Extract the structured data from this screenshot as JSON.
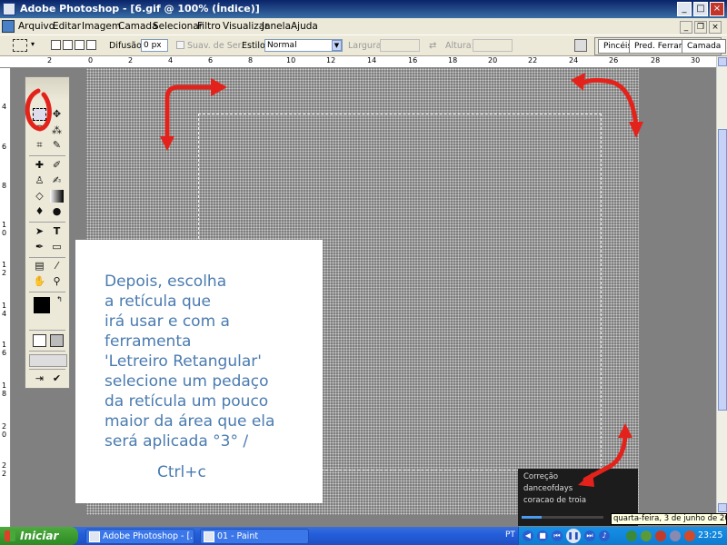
{
  "window": {
    "title": "Adobe Photoshop - [6.gif @ 100% (Índice)]",
    "controls": {
      "minimize": "_",
      "maximize": "□",
      "close": "×"
    }
  },
  "menu": [
    "Arquivo",
    "Editar",
    "Imagem",
    "Camada",
    "Selecionar",
    "Filtro",
    "Visualizar",
    "Janela",
    "Ajuda"
  ],
  "mdi_controls": {
    "minimize": "_",
    "restore": "❐",
    "close": "×"
  },
  "options": {
    "feather_label": "Difusão:",
    "feather_value": "0 px",
    "antialias_label": "Suav. de Ser.",
    "style_label": "Estilo:",
    "style_value": "Normal",
    "width_label": "Largura:",
    "height_label": "Altura:",
    "palette_tabs": [
      "Pincéis",
      "Pred. Ferram.",
      "Camada"
    ]
  },
  "rulers": {
    "top_ticks": [
      "2",
      "0",
      "2",
      "4",
      "6",
      "8",
      "10",
      "12",
      "14",
      "16",
      "18",
      "20",
      "22",
      "24",
      "26",
      "28",
      "30"
    ],
    "left_ticks": [
      "4",
      "6",
      "8",
      "1\n0",
      "1\n2",
      "1\n4",
      "1\n6",
      "1\n8",
      "2\n0",
      "2\n2"
    ]
  },
  "toolbox": {
    "tools": [
      "marquee",
      "move",
      "lasso",
      "magic-wand",
      "crop",
      "slice",
      "healing",
      "brush",
      "clone",
      "history-brush",
      "eraser",
      "gradient",
      "blur",
      "dodge",
      "path-select",
      "type",
      "pen",
      "shape",
      "notes",
      "eyedropper",
      "hand",
      "zoom"
    ]
  },
  "caption": {
    "lines": [
      "Depois, escolha",
      "a retícula   que",
      "irá usar e com a",
      "ferramenta",
      "'Letreiro Retangular'",
      "selecione um pedaço",
      "da retícula um pouco",
      "maior da área que ela",
      "será aplicada °3° /",
      "Ctrl+c"
    ]
  },
  "media": {
    "tracks": [
      "Correção",
      "danceofdays",
      "coracao de troia"
    ]
  },
  "tooltip": "quarta-feira, 3 de junho de 2009",
  "taskbar": {
    "start_label": "Iniciar",
    "tasks": [
      "Adobe Photoshop - [...",
      "01 - Paint"
    ],
    "language": "PT",
    "clock": "23:25"
  },
  "colors": {
    "annotation_red": "#e3231b",
    "caption_text": "#4a7bb0",
    "foreground_swatch": "#000000",
    "background_swatch": "#ffffff"
  }
}
